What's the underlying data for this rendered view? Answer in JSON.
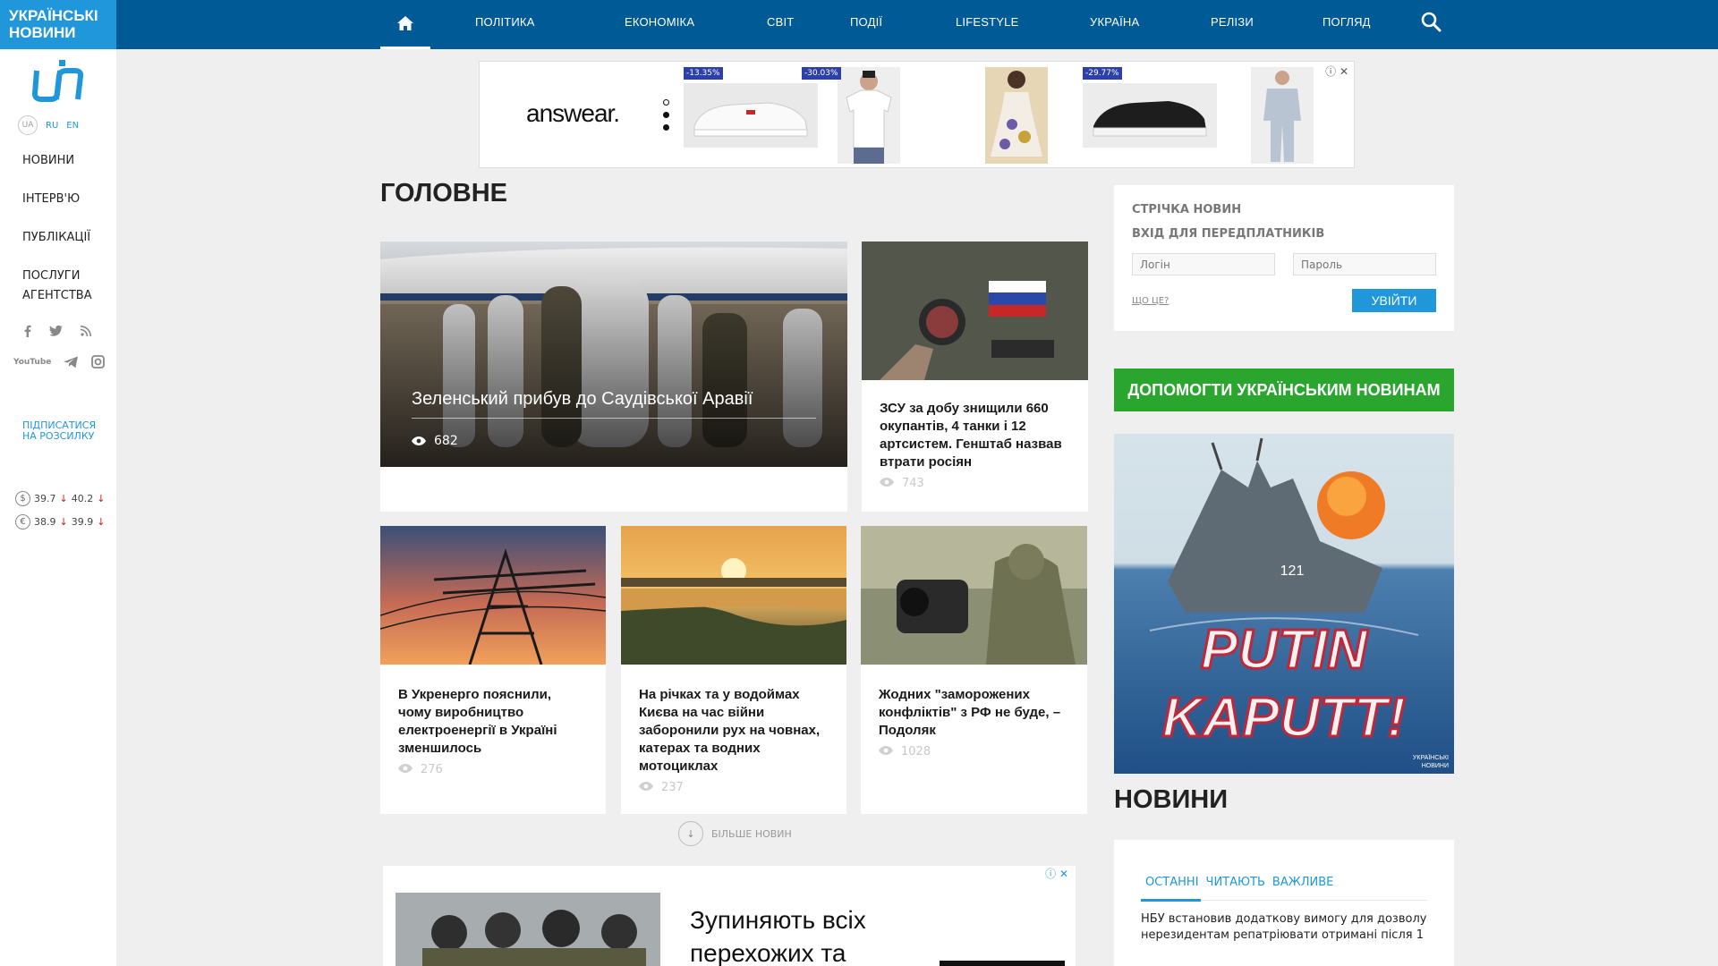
{
  "brand": {
    "line1": "УКРАЇНСЬКІ",
    "line2": "НОВИНИ"
  },
  "languages": [
    "UA",
    "RU",
    "EN"
  ],
  "sidebar": {
    "items": [
      "НОВИНИ",
      "ІНТЕРВ'Ю",
      "ПУБЛІКАЦІЇ",
      "ПОСЛУГИ АГЕНТСТВА"
    ],
    "subscribe": "ПІДПИСАТИСЯ НА РОЗСИЛКУ",
    "youtube": "YouTube",
    "rates": [
      {
        "symbol": "$",
        "buy": "39.7",
        "sell": "40.2"
      },
      {
        "symbol": "€",
        "buy": "38.9",
        "sell": "39.9"
      }
    ]
  },
  "topnav": [
    "ПОЛІТИКА",
    "ЕКОНОМІКА",
    "СВІТ",
    "ПОДІЇ",
    "LIFESTYLE",
    "УКРАЇНА",
    "РЕЛІЗИ",
    "ПОГЛЯД"
  ],
  "ad_top": {
    "brand": "answear.",
    "badges": [
      "-13.35%",
      "-30.03%",
      "-29.77%"
    ]
  },
  "main": {
    "title": "ГОЛОВНЕ",
    "hero": {
      "title": "Зеленський прибув до Саудівської Аравії",
      "views": "682"
    },
    "side_story": {
      "title": "ЗСУ за добу знищили 660 окупантів, 4 танки і 12 артсистем. Генштаб назвав втрати росіян",
      "views": "743"
    },
    "stories": [
      {
        "title": "В Укренерго пояснили, чому виробництво електроенергії в Україні зменшилось",
        "views": "276"
      },
      {
        "title": "На річках та у водоймах Києва на час війни заборонили рух на човнах, катерах та водних мотоциклах",
        "views": "237"
      },
      {
        "title": "Жодних \"заморожених конфліктів\" з РФ не буде, – Подоляк",
        "views": "1028"
      }
    ],
    "more": "БІЛЬШЕ НОВИН"
  },
  "ad_bottom": {
    "line1": "Зупиняють всіх",
    "line2": "перехожих та"
  },
  "login": {
    "feed": "СТРІЧКА НОВИН",
    "subscribers": "ВХІД ДЛЯ ПЕРЕДПЛАТНИКІВ",
    "login_placeholder": "Логін",
    "password_placeholder": "Пароль",
    "what": "ЩО ЦЕ?",
    "enter": "УВІЙТИ"
  },
  "help": "ДОПОМОГТИ УКРАЇНСЬКИМ НОВИНАМ",
  "poster": {
    "line1": "PUTIN",
    "line2": "KAPUTT!",
    "ship_number": "121",
    "logo_line1": "УКРАЇНСЬКІ",
    "logo_line2": "НОВИНИ"
  },
  "news": {
    "title": "НОВИНИ",
    "tabs": [
      "ОСТАННІ",
      "ЧИТАЮТЬ",
      "ВАЖЛИВЕ"
    ],
    "first_item": "НБУ встановив додаткову вимогу для дозволу нерезидентам репатріювати отримані після 1"
  },
  "colors": {
    "brand_blue": "#1f97da",
    "nav_blue": "#005a96",
    "help_green": "#2aa52e"
  }
}
